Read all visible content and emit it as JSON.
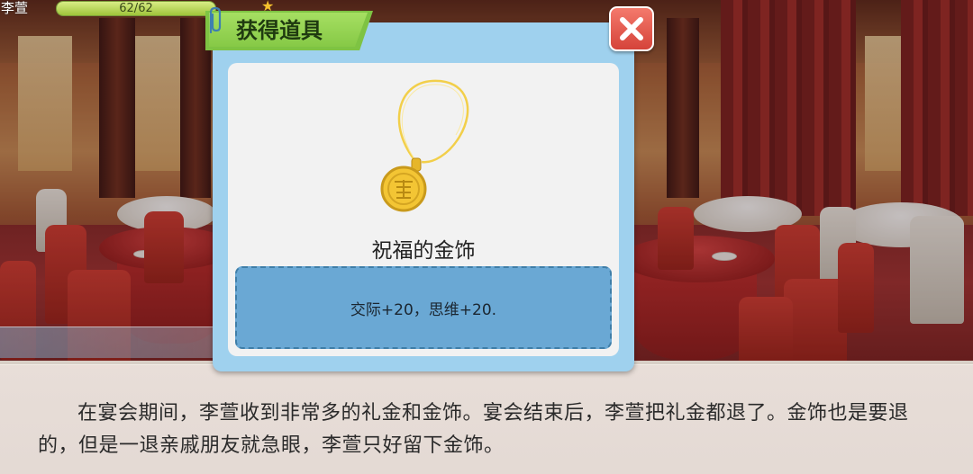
{
  "hud": {
    "character_name": "李萱",
    "stamina_text": "62/62",
    "stamina_fraction": 1.0
  },
  "popup": {
    "title": "获得道具",
    "item_name": "祝福的金饰",
    "item_effect": "交际+20，思维+20.",
    "icons": [
      "paperclip-icon",
      "close-icon",
      "gold-necklace-icon",
      "star-icon"
    ],
    "colors": {
      "frame": "#9fd1ee",
      "title_tab": "#86c946",
      "close_button": "#d5433a",
      "effect_box": "#6aa8d4"
    }
  },
  "dialogue": {
    "text": "在宴会期间，李萱收到非常多的礼金和金饰。宴会结束后，李萱把礼金都退了。金饰也是要退的，但是一退亲戚朋友就急眼，李萱只好留下金饰。"
  }
}
